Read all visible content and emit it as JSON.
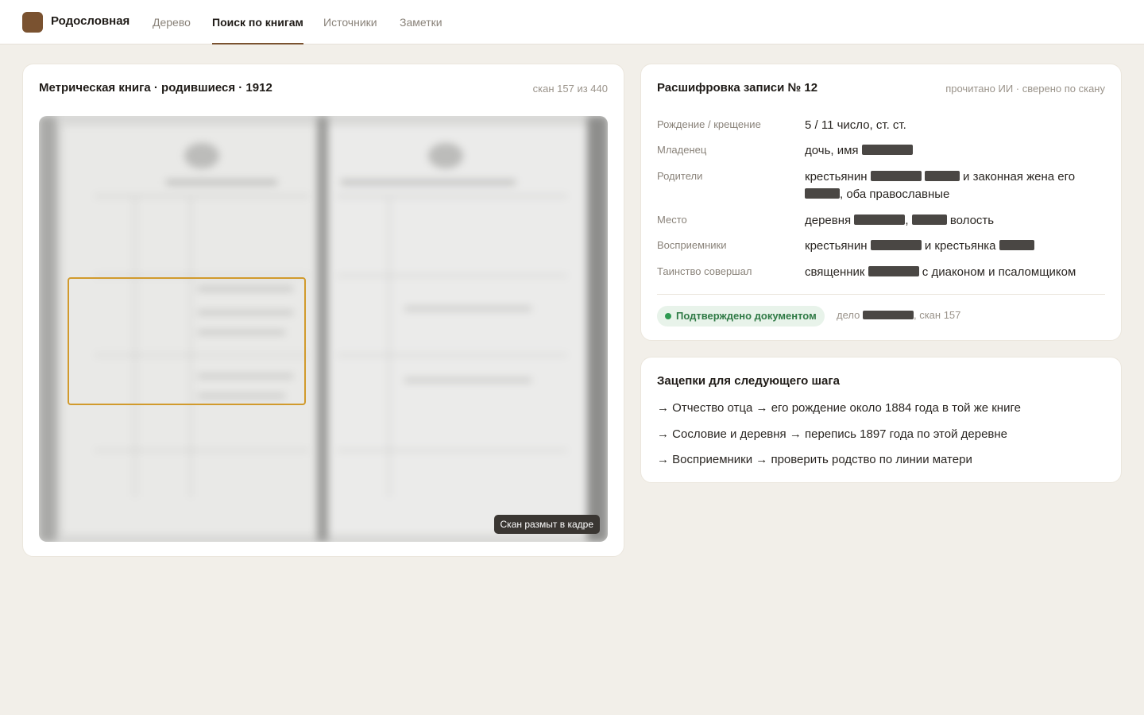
{
  "app": {
    "name": "Родословная",
    "logo_color": "#7a5230"
  },
  "nav": {
    "tabs": [
      {
        "label": "Дерево",
        "active": false
      },
      {
        "label": "Поиск по книгам",
        "active": true
      },
      {
        "label": "Источники",
        "active": false
      },
      {
        "label": "Заметки",
        "active": false
      }
    ]
  },
  "scan_card": {
    "title": "Метрическая книга · родившиеся · 1912",
    "counter": "скан 157 из 440",
    "blur_notice": "Скан размыт в кадре",
    "highlight_color": "#d19a2c"
  },
  "record_card": {
    "title": "Расшифровка записи № 12",
    "meta": "прочитано ИИ · сверено по скану",
    "fields": {
      "birth": {
        "label": "Рождение / крещение",
        "value": "5 / 11 число, ст. ст."
      },
      "infant": {
        "label": "Младенец",
        "prefix": "дочь, имя"
      },
      "parents": {
        "label": "Родители",
        "prefix": "крестьянин",
        "middle": "и законная жена его",
        "suffix": ", оба православные"
      },
      "place": {
        "label": "Место",
        "prefix": "деревня",
        "comma": ",",
        "suffix": "волость"
      },
      "godparents": {
        "label": "Восприемники",
        "prefix": "крестьянин",
        "middle": "и крестьянка"
      },
      "priest": {
        "label": "Таинство совершал",
        "prefix": "священник",
        "suffix": "с диаконом и псаломщиком"
      }
    },
    "badge": "Подтверждено документом",
    "case_prefix": "дело",
    "case_suffix": ", скан 157",
    "badge_color": "#2f7a45"
  },
  "leads_card": {
    "title": "Зацепки для следующего шага",
    "items": [
      "→ Отчество отца → его рождение около 1884 года в той же книге",
      "→ Сословие и деревня → перепись 1897 года по этой деревне",
      "→ Восприемники → проверить родство по линии матери"
    ]
  }
}
